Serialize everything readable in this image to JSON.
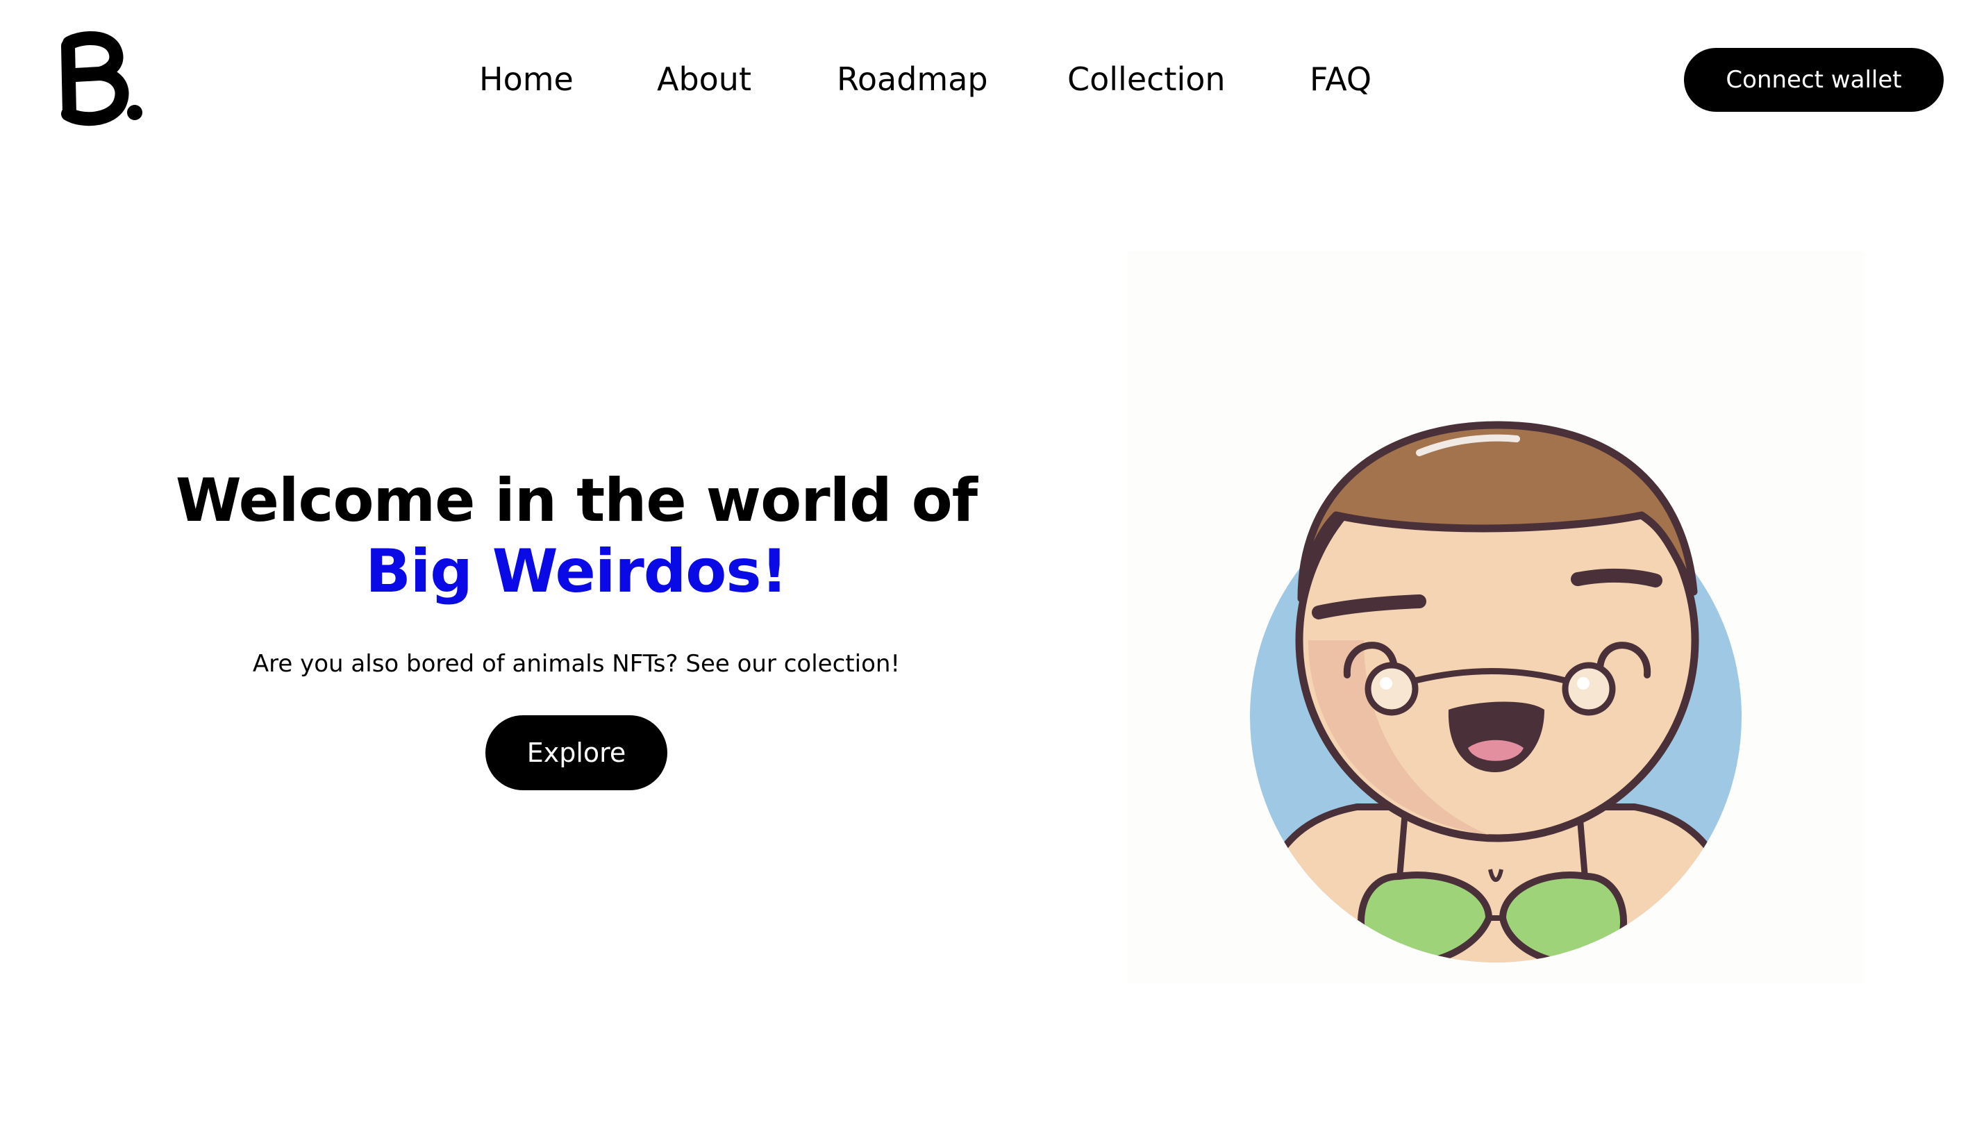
{
  "brand": {
    "logo_text": "B."
  },
  "nav": {
    "items": [
      {
        "label": "Home"
      },
      {
        "label": "About"
      },
      {
        "label": "Roadmap"
      },
      {
        "label": "Collection"
      },
      {
        "label": "FAQ"
      }
    ],
    "cta_label": "Connect wallet"
  },
  "hero": {
    "title_prefix": "Welcome in the world of ",
    "title_accent": "Big Weirdos!",
    "subtitle": "Are you also bored of animals NFTs? See our colection!",
    "button_label": "Explore",
    "image_description": "cartoon-character-avatar"
  },
  "colors": {
    "accent": "#0a0ae6",
    "button_bg": "#000000",
    "button_text": "#ffffff",
    "avatar_bg": "#9fc8e4",
    "hair": "#a2734d",
    "skin": "#f4d4b3",
    "outline": "#4a3038",
    "bra": "#9fd37a"
  }
}
